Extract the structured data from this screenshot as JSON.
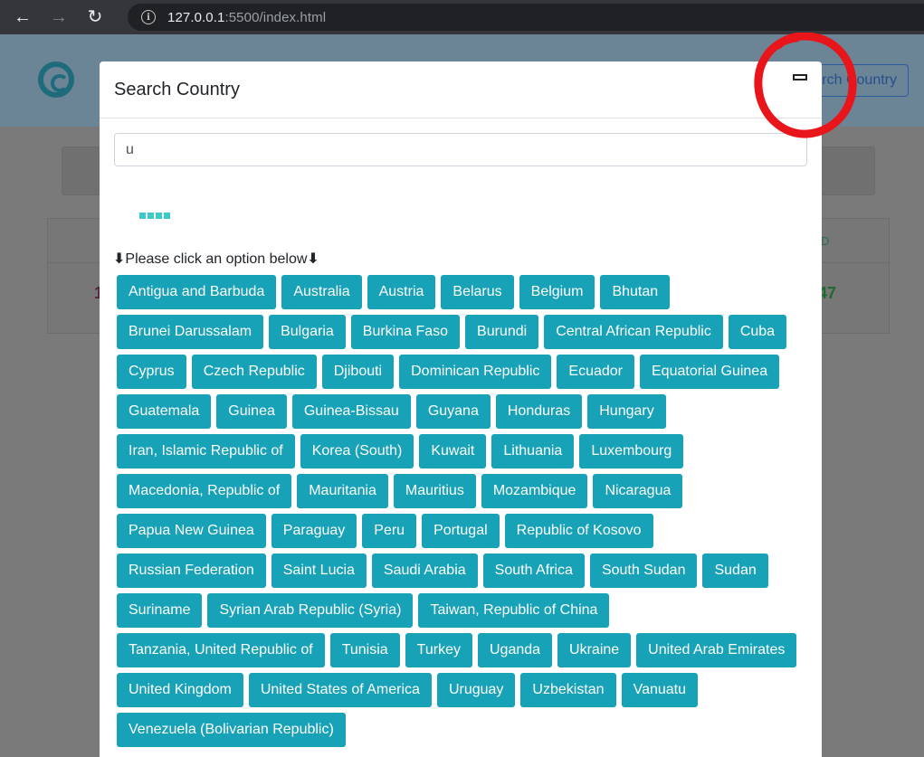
{
  "browser": {
    "url_host": "127.0.0.1",
    "url_rest": ":5500/index.html",
    "back_icon": "←",
    "forward_icon": "→",
    "reload_icon": "↻",
    "info_icon": "i"
  },
  "background_page": {
    "search_button_label": "Search Country",
    "left_number": "1",
    "right_label": "D",
    "right_number": "47"
  },
  "modal": {
    "title": "Search Country",
    "search": {
      "value": "u",
      "placeholder": ""
    },
    "instruction_arrow_left": "⬇",
    "instruction_text": "Please click an option below",
    "instruction_arrow_right": "⬇",
    "countries": [
      "Antigua and Barbuda",
      "Australia",
      "Austria",
      "Belarus",
      "Belgium",
      "Bhutan",
      "Brunei Darussalam",
      "Bulgaria",
      "Burkina Faso",
      "Burundi",
      "Central African Republic",
      "Cuba",
      "Cyprus",
      "Czech Republic",
      "Djibouti",
      "Dominican Republic",
      "Ecuador",
      "Equatorial Guinea",
      "Guatemala",
      "Guinea",
      "Guinea-Bissau",
      "Guyana",
      "Honduras",
      "Hungary",
      "Iran, Islamic Republic of",
      "Korea (South)",
      "Kuwait",
      "Lithuania",
      "Luxembourg",
      "Macedonia, Republic of",
      "Mauritania",
      "Mauritius",
      "Mozambique",
      "Nicaragua",
      "Papua New Guinea",
      "Paraguay",
      "Peru",
      "Portugal",
      "Republic of Kosovo",
      "Russian Federation",
      "Saint Lucia",
      "Saudi Arabia",
      "South Africa",
      "South Sudan",
      "Sudan",
      "Suriname",
      "Syrian Arab Republic (Syria)",
      "Taiwan, Republic of China",
      "Tanzania, United Republic of",
      "Tunisia",
      "Turkey",
      "Uganda",
      "Ukraine",
      "United Arab Emirates",
      "United Kingdom",
      "United States of America",
      "Uruguay",
      "Uzbekistan",
      "Vanuatu",
      "Venezuela (Bolivarian Republic)"
    ]
  },
  "colors": {
    "button_bg": "#17a2b8",
    "loader": "#3bc9c9",
    "annotation": "#e8161b"
  }
}
